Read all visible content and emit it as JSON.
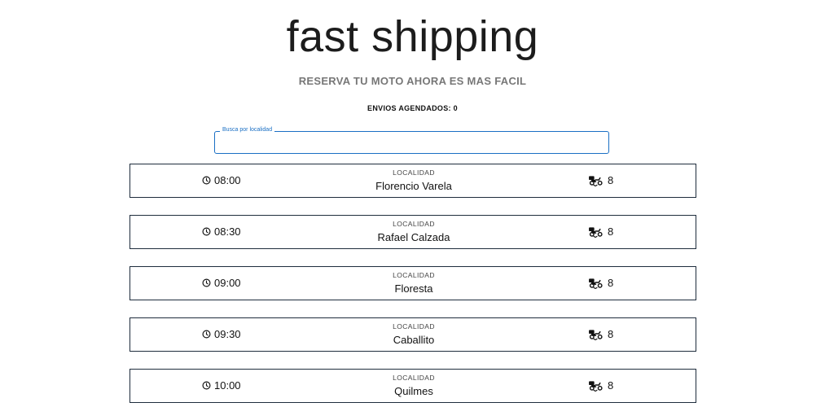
{
  "header": {
    "title": "fast shipping",
    "subtitle": "RESERVA TU MOTO AHORA ES MAS FACIL",
    "counter_label": "ENVIOS AGENDADOS:",
    "counter_value": "0"
  },
  "search": {
    "label": "Busca por localidad",
    "value": "",
    "accent_color": "#1a6fc4"
  },
  "icons": {
    "time": "clock-icon",
    "capacity": "delivery-moto-icon"
  },
  "slots": [
    {
      "time": "08:00",
      "locality_label": "LOCALIDAD",
      "locality": "Florencio Varela",
      "count": "8"
    },
    {
      "time": "08:30",
      "locality_label": "LOCALIDAD",
      "locality": "Rafael Calzada",
      "count": "8"
    },
    {
      "time": "09:00",
      "locality_label": "LOCALIDAD",
      "locality": "Floresta",
      "count": "8"
    },
    {
      "time": "09:30",
      "locality_label": "LOCALIDAD",
      "locality": "Caballito",
      "count": "8"
    },
    {
      "time": "10:00",
      "locality_label": "LOCALIDAD",
      "locality": "Quilmes",
      "count": "8"
    }
  ]
}
